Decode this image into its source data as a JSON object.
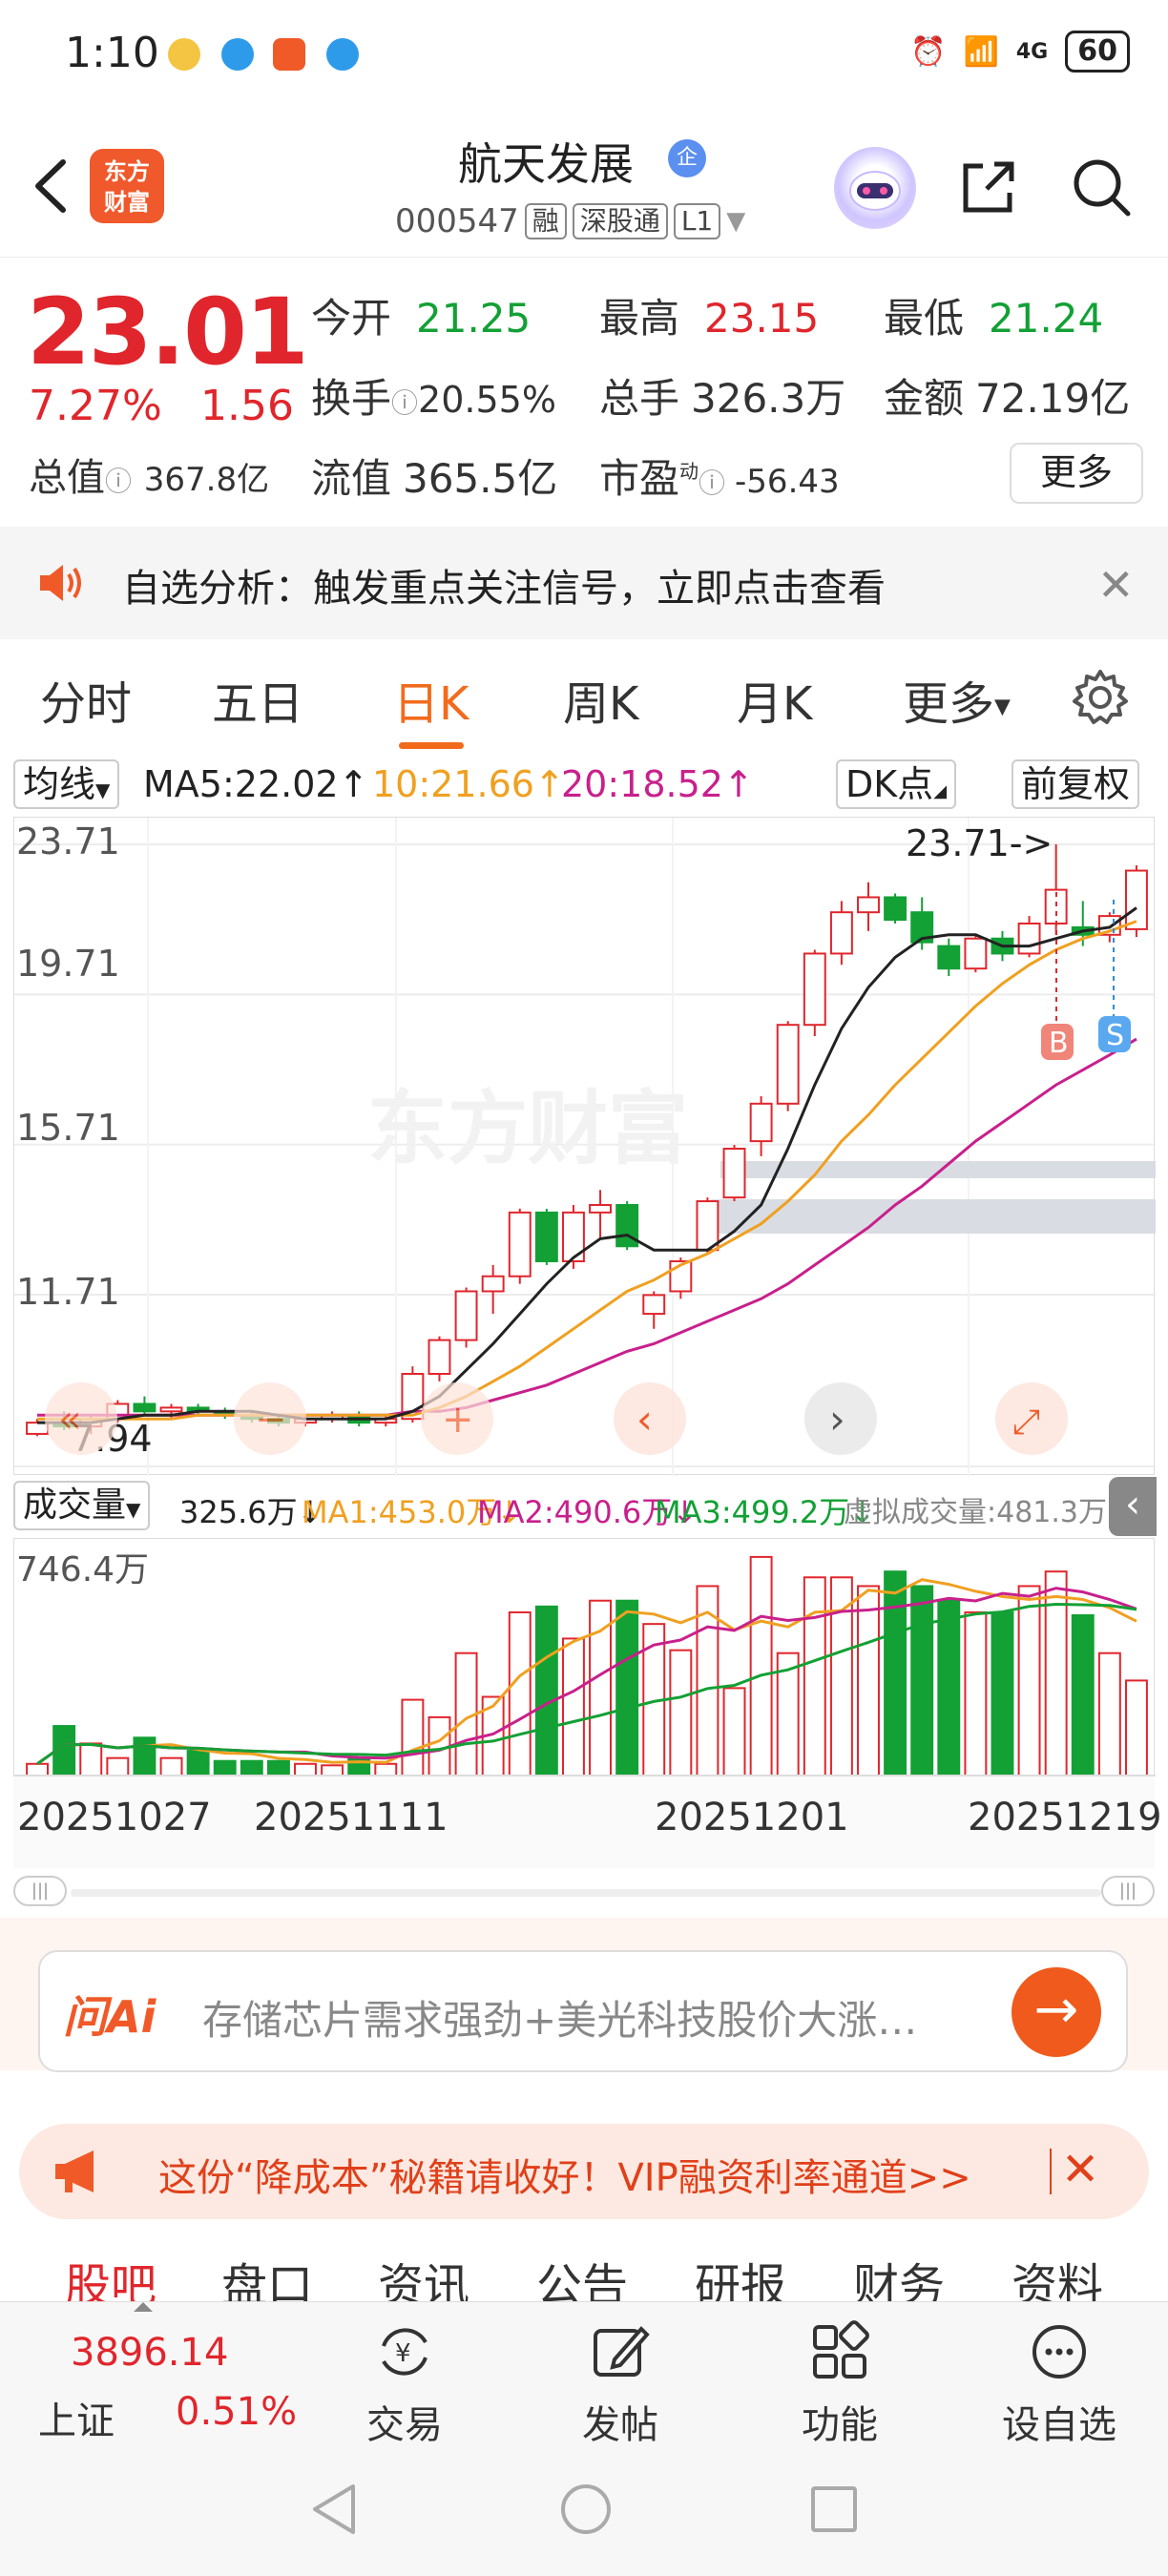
{
  "status_bar": {
    "time": "1:10",
    "network": "4G",
    "battery": "60"
  },
  "header": {
    "logo_line1": "东方",
    "logo_line2": "财富",
    "name": "航天发展",
    "badge": "企",
    "code": "000547",
    "tags": [
      "融",
      "深股通",
      "L1"
    ]
  },
  "quote": {
    "price": "23.01",
    "pct": "7.27%",
    "change": "1.56",
    "today_open_label": "今开",
    "today_open": "21.25",
    "high_label": "最高",
    "high": "23.15",
    "low_label": "最低",
    "low": "21.24",
    "turnover_label": "换手",
    "turnover": "20.55%",
    "volume_label": "总手",
    "volume": "326.3万",
    "amount_label": "金额",
    "amount": "72.19亿",
    "total_mcap_label": "总值",
    "total_mcap": "367.8亿",
    "float_mcap_label": "流值",
    "float_mcap": "365.5亿",
    "pe_label": "市盈",
    "pe_sup": "动",
    "pe": "-56.43",
    "more_label": "更多"
  },
  "alert": {
    "text": "自选分析：触发重点关注信号，立即点击查看"
  },
  "period_tabs": [
    "分时",
    "五日",
    "日K",
    "周K",
    "月K",
    "更多"
  ],
  "ma_row": {
    "selector": "均线",
    "ma5": "MA5:22.02",
    "ma10": "10:21.66",
    "ma20": "20:18.52",
    "dk": "DK点",
    "adjust": "前复权"
  },
  "chart_data": {
    "type": "candlestick",
    "watermark": "东方财富",
    "y_axis_labels": [
      "23.71",
      "19.71",
      "15.71",
      "11.71"
    ],
    "max_marker": "23.71->",
    "min_marker": "7.94",
    "buy_marker": "B",
    "sell_marker": "S",
    "candles": [
      [
        8.0,
        8.4,
        7.94,
        8.3
      ],
      [
        8.3,
        8.6,
        8.1,
        8.2
      ],
      [
        8.2,
        8.5,
        8.0,
        8.4
      ],
      [
        8.4,
        8.9,
        8.3,
        8.8
      ],
      [
        8.8,
        9.0,
        8.5,
        8.6
      ],
      [
        8.6,
        8.8,
        8.4,
        8.7
      ],
      [
        8.7,
        8.8,
        8.5,
        8.6
      ],
      [
        8.6,
        8.7,
        8.4,
        8.5
      ],
      [
        8.5,
        8.6,
        8.3,
        8.4
      ],
      [
        8.4,
        8.5,
        8.2,
        8.3
      ],
      [
        8.3,
        8.5,
        8.2,
        8.4
      ],
      [
        8.4,
        8.6,
        8.3,
        8.5
      ],
      [
        8.5,
        8.6,
        8.2,
        8.3
      ],
      [
        8.3,
        8.5,
        8.2,
        8.4
      ],
      [
        8.4,
        9.8,
        8.3,
        9.6
      ],
      [
        9.6,
        10.6,
        9.4,
        10.5
      ],
      [
        10.5,
        11.9,
        10.3,
        11.8
      ],
      [
        11.8,
        12.5,
        11.2,
        12.2
      ],
      [
        12.2,
        14.0,
        12.0,
        13.9
      ],
      [
        13.9,
        14.0,
        12.5,
        12.6
      ],
      [
        12.6,
        14.1,
        12.4,
        13.9
      ],
      [
        13.9,
        14.5,
        13.2,
        14.1
      ],
      [
        14.1,
        14.2,
        12.9,
        13.0
      ],
      [
        11.2,
        11.8,
        10.8,
        11.7
      ],
      [
        11.8,
        12.7,
        11.6,
        12.6
      ],
      [
        12.9,
        14.3,
        12.8,
        14.2
      ],
      [
        14.3,
        15.7,
        14.2,
        15.6
      ],
      [
        15.8,
        17.0,
        15.4,
        16.8
      ],
      [
        16.8,
        19.0,
        16.6,
        18.9
      ],
      [
        18.9,
        20.9,
        18.6,
        20.8
      ],
      [
        20.8,
        22.2,
        20.5,
        21.9
      ],
      [
        21.9,
        22.7,
        21.4,
        22.3
      ],
      [
        22.3,
        22.4,
        21.6,
        21.7
      ],
      [
        21.9,
        22.3,
        20.9,
        21.1
      ],
      [
        21.0,
        21.2,
        20.2,
        20.4
      ],
      [
        20.4,
        21.3,
        20.3,
        21.2
      ],
      [
        21.2,
        21.4,
        20.6,
        20.8
      ],
      [
        20.8,
        21.8,
        20.7,
        21.6
      ],
      [
        21.6,
        23.71,
        21.3,
        22.5
      ],
      [
        21.5,
        22.2,
        21.0,
        21.3
      ],
      [
        21.3,
        21.9,
        21.1,
        21.8
      ],
      [
        21.45,
        23.15,
        21.24,
        23.01
      ]
    ],
    "ma5": [
      8.3,
      8.3,
      8.3,
      8.4,
      8.5,
      8.5,
      8.6,
      8.6,
      8.6,
      8.5,
      8.4,
      8.4,
      8.4,
      8.4,
      8.6,
      9.0,
      9.7,
      10.4,
      11.2,
      12.0,
      12.7,
      13.2,
      13.3,
      12.9,
      12.9,
      12.9,
      13.4,
      14.1,
      15.6,
      17.3,
      18.8,
      19.9,
      20.7,
      21.2,
      21.3,
      21.3,
      21.0,
      21.0,
      21.2,
      21.4,
      21.5,
      22.02
    ],
    "ma10": [
      8.4,
      8.4,
      8.4,
      8.4,
      8.4,
      8.4,
      8.5,
      8.5,
      8.5,
      8.5,
      8.5,
      8.5,
      8.5,
      8.5,
      8.5,
      8.7,
      9.0,
      9.4,
      9.8,
      10.3,
      10.8,
      11.3,
      11.8,
      12.1,
      12.5,
      12.8,
      13.2,
      13.6,
      14.2,
      14.9,
      15.8,
      16.5,
      17.3,
      18.0,
      18.7,
      19.4,
      20.0,
      20.5,
      20.9,
      21.2,
      21.4,
      21.66
    ],
    "ma20": [
      8.5,
      8.5,
      8.5,
      8.5,
      8.5,
      8.5,
      8.5,
      8.5,
      8.5,
      8.5,
      8.5,
      8.5,
      8.5,
      8.5,
      8.6,
      8.6,
      8.7,
      8.9,
      9.1,
      9.3,
      9.6,
      9.9,
      10.2,
      10.4,
      10.7,
      11.0,
      11.3,
      11.6,
      12.0,
      12.5,
      13.0,
      13.5,
      14.1,
      14.6,
      15.2,
      15.8,
      16.3,
      16.8,
      17.3,
      17.7,
      18.1,
      18.52
    ],
    "volume_header": {
      "selector": "成交量",
      "vol": "325.6万",
      "ma1": "MA1:453.0万",
      "ma2": "MA2:490.6万",
      "ma3": "MA3:499.2万",
      "virtual": "虚拟成交量:481.3万",
      "y_max_label": "746.4万"
    },
    "volume": [
      40,
      170,
      110,
      60,
      130,
      60,
      85,
      50,
      50,
      50,
      40,
      35,
      60,
      40,
      260,
      200,
      420,
      270,
      560,
      580,
      470,
      600,
      600,
      520,
      430,
      650,
      300,
      750,
      420,
      680,
      680,
      650,
      700,
      650,
      600,
      560,
      560,
      650,
      700,
      550,
      420,
      326
    ],
    "dates": [
      "20251027",
      "20251111",
      "20251201",
      "20251219"
    ]
  },
  "ai_bar": {
    "logo": "问Ai",
    "text": "存储芯片需求强劲+美光科技股价大涨…"
  },
  "promo": {
    "text": "这份“降成本”秘籍请收好！VIP融资利率通道>>"
  },
  "info_tabs": [
    "股吧",
    "盘口",
    "资讯",
    "公告",
    "研报",
    "财务",
    "资料"
  ],
  "bottom_nav": {
    "index_value": "3896.14",
    "index_name": "上证",
    "index_pct": "0.51%",
    "trade": "交易",
    "post": "发帖",
    "func": "功能",
    "watch": "设自选"
  },
  "colors": {
    "up": "#e0262c",
    "down": "#13a035",
    "accent": "#f26b1d",
    "ma5": "#222222",
    "ma10": "#f0a020",
    "ma20": "#c8208c"
  }
}
